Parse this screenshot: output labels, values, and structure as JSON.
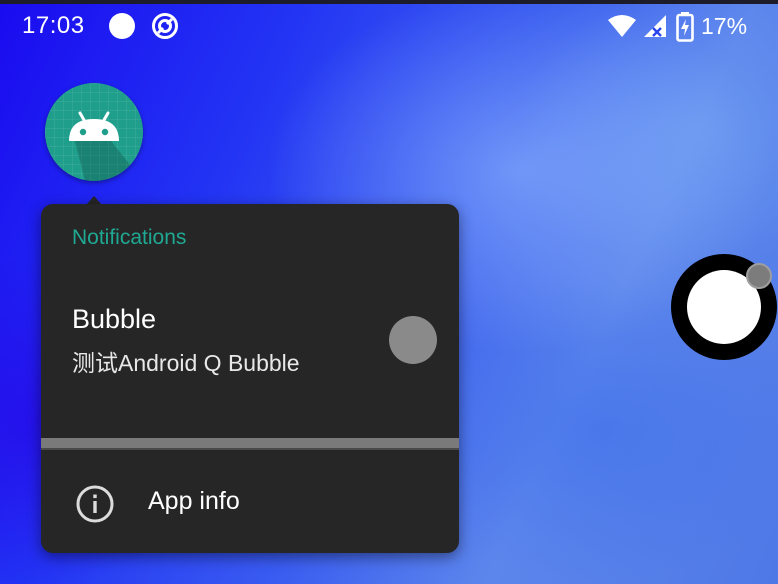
{
  "status_bar": {
    "time": "17:03",
    "battery_percent": "17%",
    "icons": [
      "notification-dot-icon",
      "sync-icon",
      "wifi-icon",
      "cellular-signal-icon",
      "battery-charging-icon"
    ]
  },
  "bubble": {
    "icon": "android-app-icon",
    "accent_color": "#1e9e8a"
  },
  "popup": {
    "section_header": "Notifications",
    "channel": {
      "title": "Bubble",
      "description": "测试Android Q Bubble",
      "enabled": false
    },
    "app_info_label": "App info",
    "app_info_icon": "info-icon"
  },
  "floating_bubble": {
    "icon": "bubble-chat-head-icon"
  },
  "colors": {
    "header_accent": "#1fa893",
    "popup_background": "#262626",
    "toggle_off": "#8a8a8a"
  }
}
